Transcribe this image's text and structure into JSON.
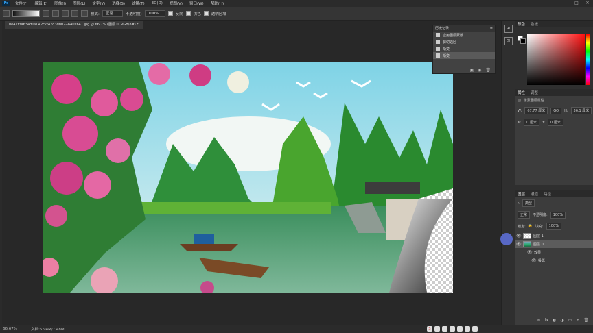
{
  "menu": [
    "文件(F)",
    "编辑(E)",
    "图像(I)",
    "图层(L)",
    "文字(Y)",
    "选择(S)",
    "滤镜(T)",
    "3D(D)",
    "视图(V)",
    "窗口(W)",
    "帮助(H)"
  ],
  "logo": "Ps",
  "window_controls": [
    "—",
    "□",
    "✕"
  ],
  "options": {
    "mode_label": "模式:",
    "mode_value": "正常",
    "opacity_label": "不透明度:",
    "opacity_value": "100%",
    "reverse_label": "反向",
    "dither_label": "仿色",
    "transparency_label": "透明区域"
  },
  "document_tab": "0e41f3a634d09042c7f47d3db02--640x641.jpg @ 66.7% (图层 0, RGB/8#) *",
  "history_panel": {
    "title": "历史记录",
    "items": [
      {
        "label": "应用图层蒙版",
        "selected": false
      },
      {
        "label": "剪切选区",
        "selected": false
      },
      {
        "label": "渐变",
        "selected": false
      },
      {
        "label": "渐变",
        "selected": true
      }
    ]
  },
  "color_panel": {
    "tabs": [
      "颜色",
      "色板"
    ],
    "fg_color": "#ffffff",
    "bg_color": "#000000"
  },
  "properties_panel": {
    "tabs": [
      "属性",
      "调整"
    ],
    "title": "像素图层属性",
    "w": "67.77 厘米",
    "h": "36.1 厘米",
    "x": "0 厘米",
    "y": "0 厘米",
    "link": "GO"
  },
  "layers_panel": {
    "tabs": [
      "图层",
      "通道",
      "路径"
    ],
    "kind_label": "类型",
    "blend_mode": "正常",
    "opacity_label": "不透明度:",
    "opacity_value": "100%",
    "lock_label": "锁定:",
    "fill_label": "填充:",
    "fill_value": "100%",
    "layers": [
      {
        "name": "图层 1",
        "thumb": "checker",
        "selected": false
      },
      {
        "name": "图层 0",
        "thumb": "img",
        "selected": true
      },
      {
        "name": "效果",
        "thumb": "",
        "selected": false
      },
      {
        "name": "投影",
        "thumb": "",
        "selected": false
      }
    ]
  },
  "status": {
    "zoom": "66.67%",
    "doc": "文档:5.94M/7.48M"
  }
}
